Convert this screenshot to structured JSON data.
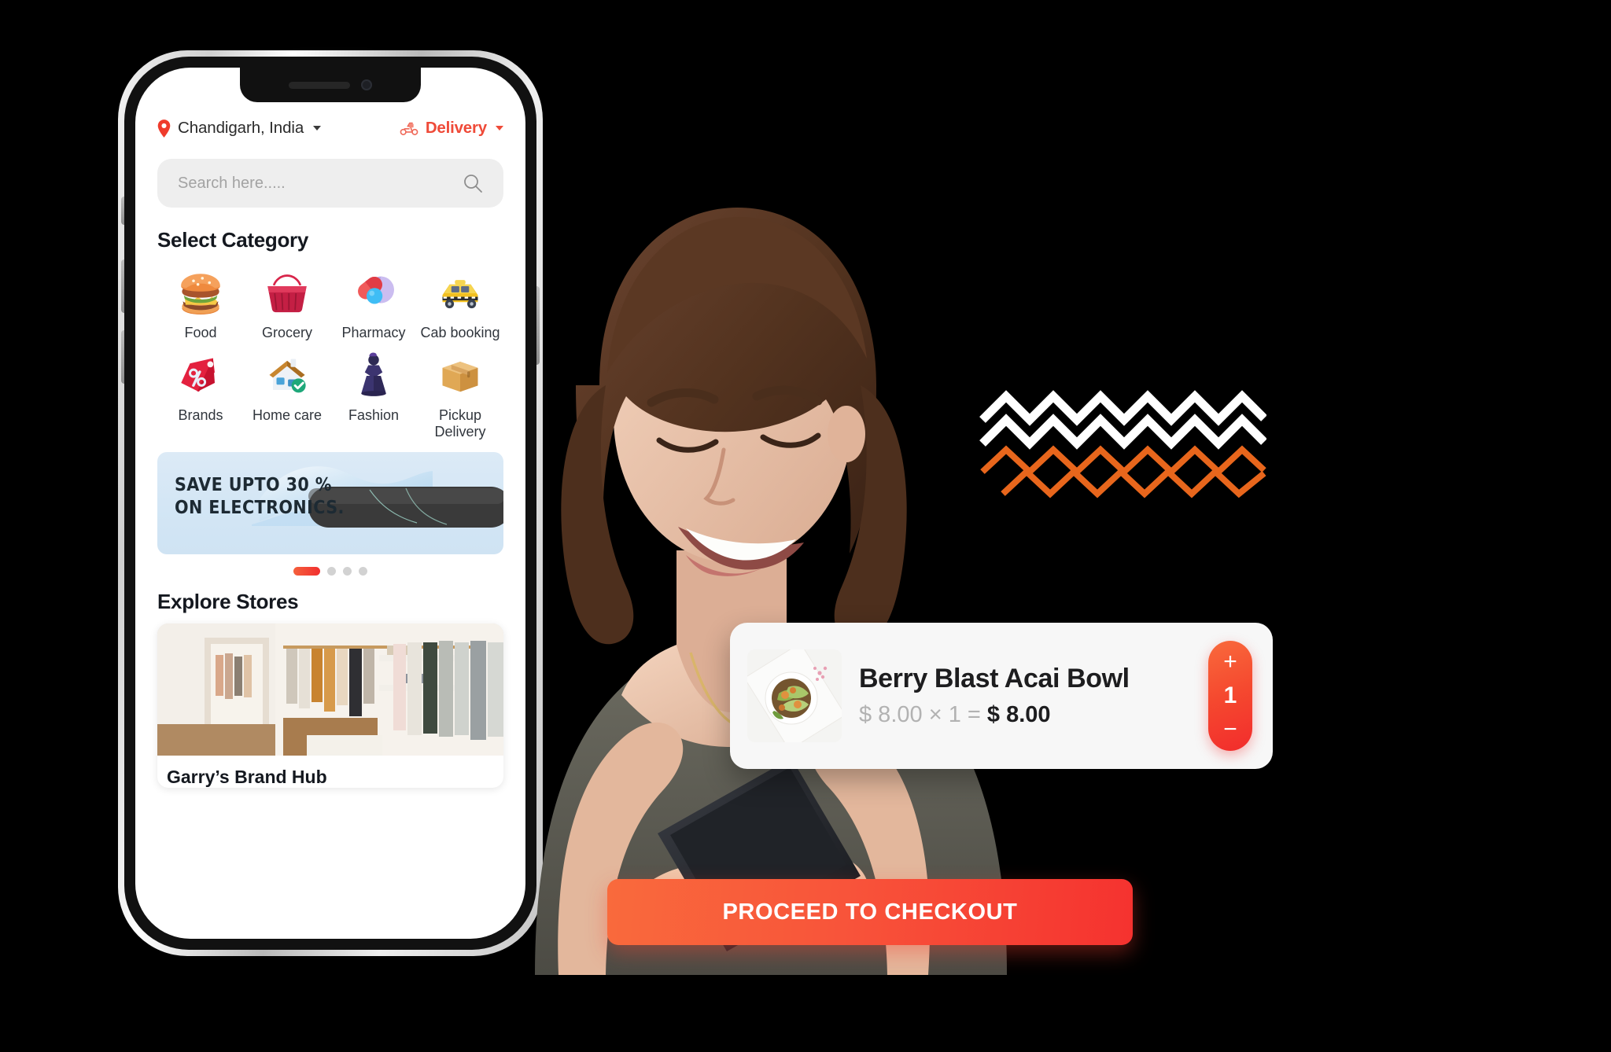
{
  "background_color": "#000000",
  "accent_color": "#ef4a38",
  "phone": {
    "device_name": "smartphone-mockup",
    "app": {
      "location": {
        "icon": "location-pin-icon",
        "label": "Chandigarh, India",
        "caret": "chevron-down-icon"
      },
      "delivery": {
        "icon": "scooter-delivery-icon",
        "label": "Delivery",
        "caret": "chevron-down-icon"
      },
      "search": {
        "placeholder": "Search here.....",
        "value": "",
        "icon": "search-icon"
      },
      "category_section": {
        "title": "Select Category",
        "items": [
          {
            "label": "Food",
            "icon": "burger-icon"
          },
          {
            "label": "Grocery",
            "icon": "shopping-basket-icon"
          },
          {
            "label": "Pharmacy",
            "icon": "pills-icon"
          },
          {
            "label": "Cab booking",
            "icon": "taxi-icon"
          },
          {
            "label": "Brands",
            "icon": "discount-tag-icon"
          },
          {
            "label": "Home care",
            "icon": "house-shield-icon"
          },
          {
            "label": "Fashion",
            "icon": "dress-mannequin-icon"
          },
          {
            "label": "Pickup Delivery",
            "icon": "parcel-box-icon"
          }
        ]
      },
      "banner": {
        "line1": "SAVE UPTO 30 %",
        "line2": "ON ELECTRONICS.",
        "background_color": "#d7e9f6"
      },
      "carousel": {
        "total_dots": 4,
        "active_index": 0,
        "active_color": "#f2402f",
        "inactive_color": "#d2d2d2"
      },
      "stores_section": {
        "title": "Explore Stores",
        "cards": [
          {
            "name": "Garry’s Brand Hub",
            "image": "clothing-boutique-photo"
          }
        ]
      }
    }
  },
  "hero_photo": {
    "alt": "smiling-woman-using-phone"
  },
  "decoration": {
    "zigzag_white_color": "#ffffff",
    "zigzag_orange_color": "#e8661c"
  },
  "product_card": {
    "thumbnail": "acai-bowl-photo",
    "name": "Berry Blast Acai Bowl",
    "unit_price": "$ 8.00",
    "multiply_symbol": "×",
    "quantity": "1",
    "equals_symbol": "=",
    "total_price": "$ 8.00",
    "stepper": {
      "increase": "+",
      "quantity": "1",
      "decrease": "−"
    }
  },
  "checkout_button": {
    "label": "PROCEED TO CHECKOUT",
    "color_from": "#f96a3c",
    "color_to": "#f5322f"
  }
}
